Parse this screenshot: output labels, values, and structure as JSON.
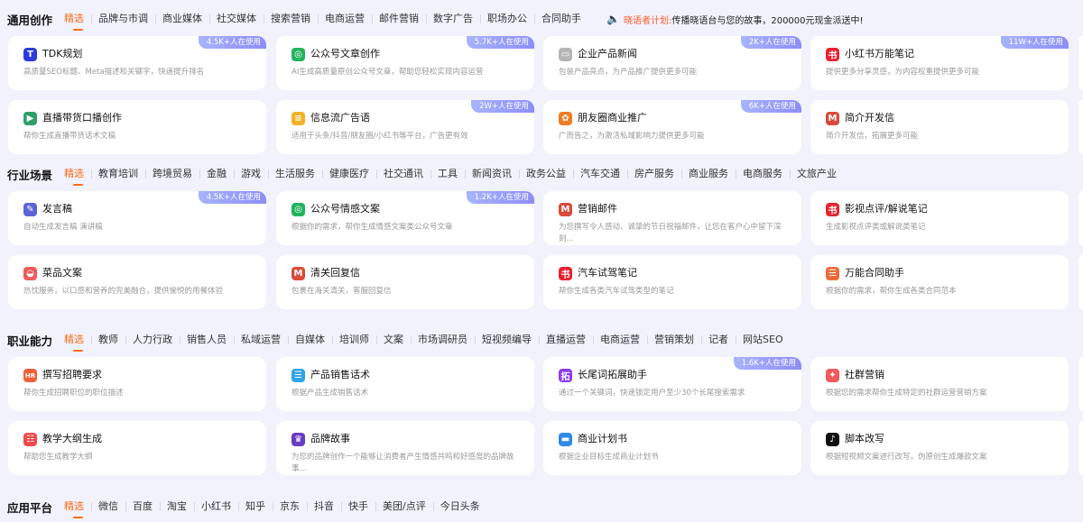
{
  "sections": [
    {
      "title": "通用创作",
      "tabs": [
        "精选",
        "品牌与市调",
        "商业媒体",
        "社交媒体",
        "搜索营销",
        "电商运营",
        "邮件营销",
        "数字广告",
        "职场办公",
        "合同助手"
      ],
      "announcement": {
        "label": "晓语者计划:",
        "text": "传播晓语台与您的故事，200000元现金派送中!"
      },
      "cards": [
        {
          "title": "TDK规划",
          "desc": "高质量SEO标题、Meta描述和关键字，快速提升排名",
          "badge": "4.5K+人在使用",
          "icon": "tdk-icon",
          "color": "#2d3bdc",
          "glyph": "T"
        },
        {
          "title": "公众号文章创作",
          "desc": "AI生成高质量原创公众号文章，帮助您轻松实现内容运营",
          "badge": "5.7K+人在使用",
          "icon": "wechat-official-icon",
          "color": "#22b35e",
          "glyph": "◎"
        },
        {
          "title": "企业产品新闻",
          "desc": "包装产品亮点，为产品推广提供更多可能",
          "badge": "2K+人在使用",
          "icon": "news-icon",
          "color": "#b5b5b5",
          "glyph": "▭"
        },
        {
          "title": "小红书万能笔记",
          "desc": "提供更多分享灵感，为内容权重提供更多可能",
          "badge": "11W+人在使用",
          "icon": "xiaohongshu-icon",
          "color": "#e8232f",
          "glyph": "书"
        },
        {
          "title": "直播带货口播创作",
          "desc": "帮你生成直播带货话术文稿",
          "badge": "",
          "icon": "live-stream-icon",
          "color": "#2f9e6a",
          "glyph": "▶"
        },
        {
          "title": "信息流广告语",
          "desc": "适用于头条/抖音/朋友圈/小红书等平台，广告更有效",
          "badge": "2W+人在使用",
          "icon": "document-icon",
          "color": "#f2b227",
          "glyph": "≡"
        },
        {
          "title": "朋友圈商业推广",
          "desc": "广而告之，为激活私域影响力提供更多可能",
          "badge": "6K+人在使用",
          "icon": "moments-icon",
          "color": "#f07c24",
          "glyph": "✿"
        },
        {
          "title": "简介开发信",
          "desc": "简介开发信，拓展更多可能",
          "badge": "",
          "icon": "gmail-icon",
          "color": "#d94a3a",
          "glyph": "M"
        }
      ]
    },
    {
      "title": "行业场景",
      "tabs": [
        "精选",
        "教育培训",
        "跨境贸易",
        "金融",
        "游戏",
        "生活服务",
        "健康医疗",
        "社交通讯",
        "工具",
        "新闻资讯",
        "政务公益",
        "汽车交通",
        "房产服务",
        "商业服务",
        "电商服务",
        "文旅产业"
      ],
      "cards": [
        {
          "title": "发言稿",
          "desc": "自动生成发言稿 演讲稿",
          "badge": "4.5K+人在使用",
          "icon": "pen-icon",
          "color": "#5b63d8",
          "glyph": "✎"
        },
        {
          "title": "公众号情感文案",
          "desc": "根据你的需求，帮你生成情感文案类公众号文章",
          "badge": "1.2K+人在使用",
          "icon": "wechat-official-icon",
          "color": "#22b35e",
          "glyph": "◎"
        },
        {
          "title": "营销邮件",
          "desc": "为您撰写令人感动、诚挚的节日祝福邮件，让您在客户心中留下深刻...",
          "badge": "",
          "icon": "gmail-icon",
          "color": "#d94a3a",
          "glyph": "M"
        },
        {
          "title": "影视点评/解说笔记",
          "desc": "生成影视点评类或解说类笔记",
          "badge": "",
          "icon": "xiaohongshu-icon",
          "color": "#e8232f",
          "glyph": "书"
        },
        {
          "title": "菜品文案",
          "desc": "热忱服务，以口感和营养的完美融合，提供愉悦的用餐体验",
          "badge": "",
          "icon": "dish-icon",
          "color": "#f05a5a",
          "glyph": "◒"
        },
        {
          "title": "清关回复信",
          "desc": "包裹在海关清关，客服回复信",
          "badge": "",
          "icon": "gmail-icon",
          "color": "#d94a3a",
          "glyph": "M"
        },
        {
          "title": "汽车试驾笔记",
          "desc": "帮你生成各类汽车试驾类型的笔记",
          "badge": "",
          "icon": "xiaohongshu-icon",
          "color": "#e8232f",
          "glyph": "书"
        },
        {
          "title": "万能合同助手",
          "desc": "根据你的需求，帮你生成各类合同范本",
          "badge": "",
          "icon": "contract-icon",
          "color": "#f06a3a",
          "glyph": "☰"
        }
      ]
    },
    {
      "title": "职业能力",
      "tabs": [
        "精选",
        "教师",
        "人力行政",
        "销售人员",
        "私域运营",
        "自媒体",
        "培训师",
        "文案",
        "市场调研员",
        "短视频编导",
        "直播运营",
        "电商运营",
        "营销策划",
        "记者",
        "网站SEO"
      ],
      "cards": [
        {
          "title": "撰写招聘要求",
          "desc": "帮你生成招聘职位的职位描述",
          "badge": "",
          "icon": "hr-icon",
          "color": "#f0603a",
          "glyph": "HR"
        },
        {
          "title": "产品销售话术",
          "desc": "根据产品生成销售话术",
          "badge": "",
          "icon": "chat-icon",
          "color": "#2fa4e8",
          "glyph": "☰"
        },
        {
          "title": "长尾词拓展助手",
          "desc": "通过一个关键词，快速锁定用户至少30个长尾搜索需求",
          "badge": "1.6K+人在使用",
          "icon": "expand-icon",
          "color": "#8a3cf0",
          "glyph": "拓"
        },
        {
          "title": "社群营销",
          "desc": "根据您的需求帮你生成特定的社群运营营销方案",
          "badge": "",
          "icon": "community-icon",
          "color": "#f05a5a",
          "glyph": "✦"
        },
        {
          "title": "教学大纲生成",
          "desc": "帮助您生成教学大纲",
          "badge": "",
          "icon": "list-icon",
          "color": "#f04a4a",
          "glyph": "☷"
        },
        {
          "title": "品牌故事",
          "desc": "为您的品牌创作一个能够让消费者产生情感共鸣和好感度的品牌故事...",
          "badge": "",
          "icon": "brand-icon",
          "color": "#6a3cc0",
          "glyph": "♛"
        },
        {
          "title": "商业计划书",
          "desc": "根据企业目标生成商业计划书",
          "badge": "",
          "icon": "plan-icon",
          "color": "#2f8ae8",
          "glyph": "▬"
        },
        {
          "title": "脚本改写",
          "desc": "根据短视频文案进行改写，伪原创生成爆款文案",
          "badge": "",
          "icon": "tiktok-icon",
          "color": "#111111",
          "glyph": "♪"
        }
      ]
    },
    {
      "title": "应用平台",
      "tabs": [
        "精选",
        "微信",
        "百度",
        "淘宝",
        "小红书",
        "知乎",
        "京东",
        "抖音",
        "快手",
        "美团/点评",
        "今日头条"
      ],
      "cards": []
    }
  ]
}
